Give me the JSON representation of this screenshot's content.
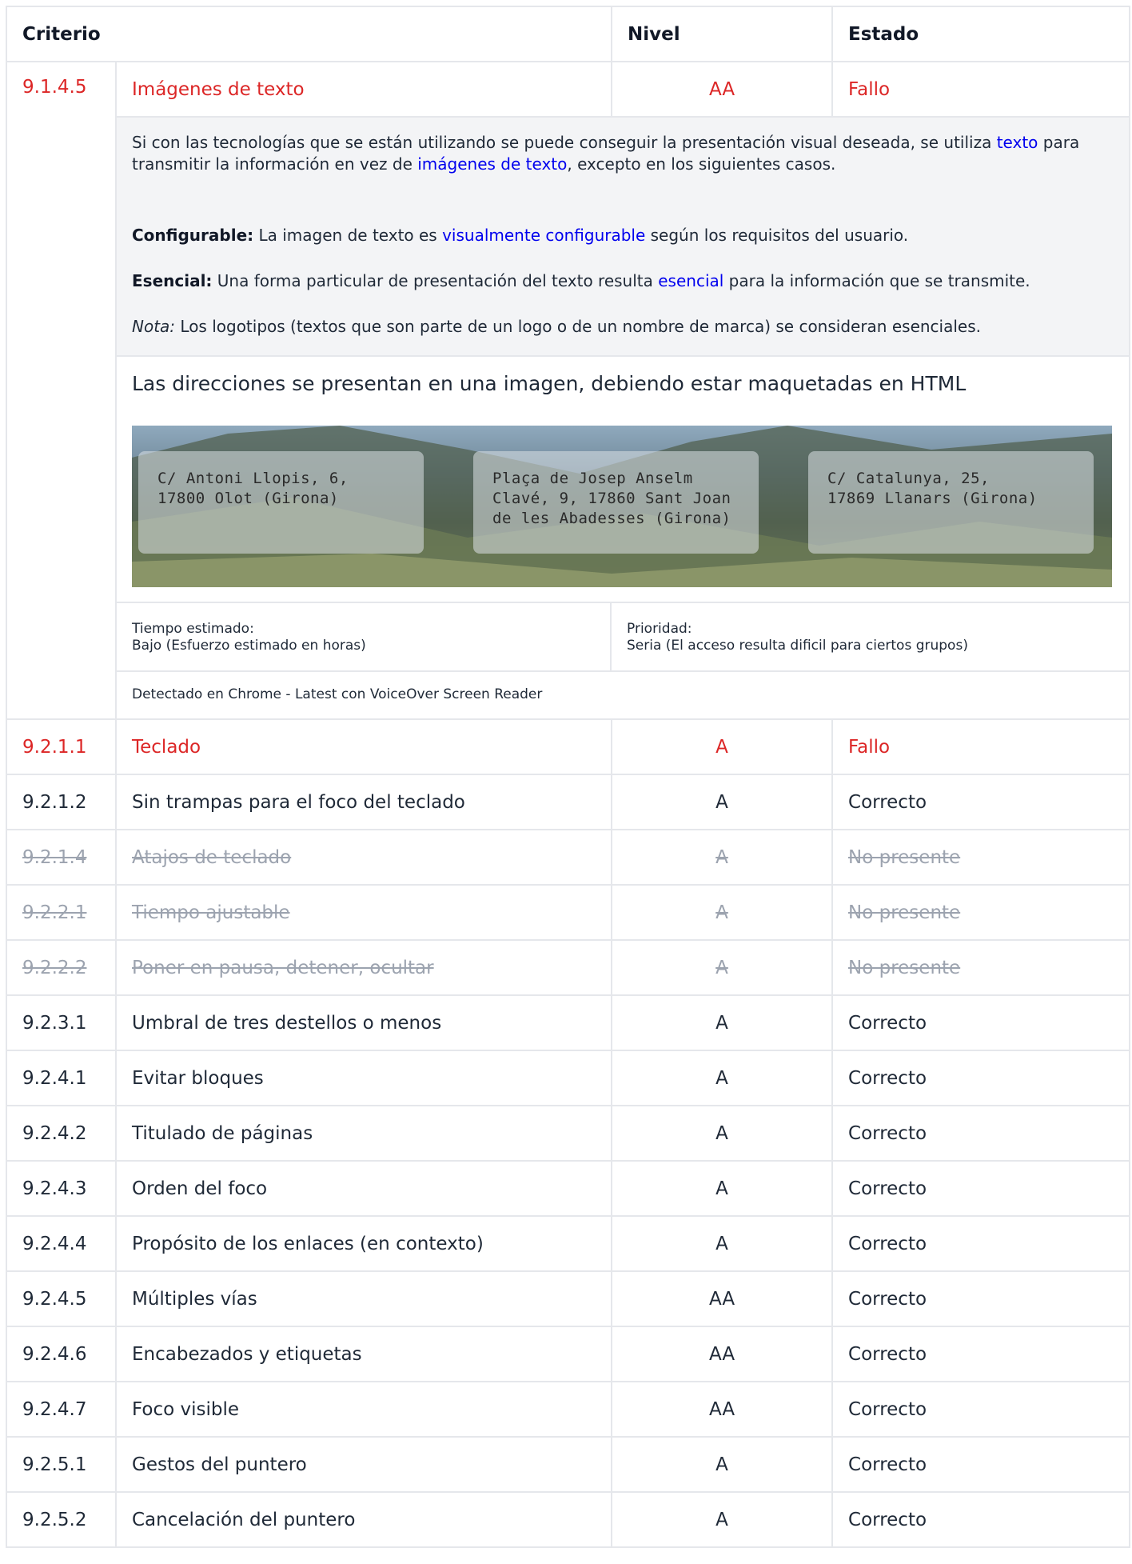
{
  "header": {
    "criterio": "Criterio",
    "nivel": "Nivel",
    "estado": "Estado"
  },
  "expanded": {
    "id": "9.1.4.5",
    "name": "Imágenes de texto",
    "nivel": "AA",
    "estado": "Fallo",
    "desc1_a": "Si con las tecnologías que se están utilizando se puede conseguir la presentación visual deseada, se utiliza ",
    "desc1_link1": "texto",
    "desc1_b": " para transmitir la información en vez de ",
    "desc1_link2": "imágenes de texto",
    "desc1_c": ", excepto en los siguientes casos.",
    "config_label": "Configurable:",
    "config_a": " La imagen de texto es ",
    "config_link": "visualmente configurable",
    "config_b": " según los requisitos del usuario.",
    "esencial_label": "Esencial:",
    "esencial_a": " Una forma particular de presentación del texto resulta ",
    "esencial_link": "esencial",
    "esencial_b": " para la información que se transmite.",
    "nota_label": "Nota:",
    "nota_text": " Los logotipos (textos que son parte de un logo o de un nombre de marca) se consideran esenciales.",
    "issue_title": "Las direcciones se presentan en una imagen, debiendo estar maquetadas en HTML",
    "addresses": [
      {
        "line1": "C/ Antoni Llopis, 6,",
        "line2": "17800 Olot (Girona)",
        "line3": ""
      },
      {
        "line1": "Plaça de Josep Anselm",
        "line2": "Clavé, 9, 17860 Sant Joan",
        "line3": "de les Abadesses (Girona)"
      },
      {
        "line1": "C/ Catalunya, 25,",
        "line2": "17869 Llanars (Girona)",
        "line3": ""
      }
    ],
    "tiempo_label": "Tiempo estimado:",
    "tiempo_value": "Bajo (Esfuerzo estimado en horas)",
    "prioridad_label": "Prioridad:",
    "prioridad_value": "Seria (El acceso resulta dificil para ciertos grupos)",
    "detected": "Detectado en Chrome - Latest con VoiceOver Screen Reader"
  },
  "rows": [
    {
      "id": "9.2.1.1",
      "name": "Teclado",
      "nivel": "A",
      "estado": "Fallo"
    },
    {
      "id": "9.2.1.2",
      "name": "Sin trampas para el foco del teclado",
      "nivel": "A",
      "estado": "Correcto"
    },
    {
      "id": "9.2.1.4",
      "name": "Atajos de teclado",
      "nivel": "A",
      "estado": "No presente"
    },
    {
      "id": "9.2.2.1",
      "name": "Tiempo ajustable",
      "nivel": "A",
      "estado": "No presente"
    },
    {
      "id": "9.2.2.2",
      "name": "Poner en pausa, detener, ocultar",
      "nivel": "A",
      "estado": "No presente"
    },
    {
      "id": "9.2.3.1",
      "name": "Umbral de tres destellos o menos",
      "nivel": "A",
      "estado": "Correcto"
    },
    {
      "id": "9.2.4.1",
      "name": "Evitar bloques",
      "nivel": "A",
      "estado": "Correcto"
    },
    {
      "id": "9.2.4.2",
      "name": "Titulado de páginas",
      "nivel": "A",
      "estado": "Correcto"
    },
    {
      "id": "9.2.4.3",
      "name": "Orden del foco",
      "nivel": "A",
      "estado": "Correcto"
    },
    {
      "id": "9.2.4.4",
      "name": "Propósito de los enlaces (en contexto)",
      "nivel": "A",
      "estado": "Correcto"
    },
    {
      "id": "9.2.4.5",
      "name": "Múltiples vías",
      "nivel": "AA",
      "estado": "Correcto"
    },
    {
      "id": "9.2.4.6",
      "name": "Encabezados y etiquetas",
      "nivel": "AA",
      "estado": "Correcto"
    },
    {
      "id": "9.2.4.7",
      "name": "Foco visible",
      "nivel": "AA",
      "estado": "Correcto"
    },
    {
      "id": "9.2.5.1",
      "name": "Gestos del puntero",
      "nivel": "A",
      "estado": "Correcto"
    },
    {
      "id": "9.2.5.2",
      "name": "Cancelación del puntero",
      "nivel": "A",
      "estado": "Correcto"
    }
  ],
  "colors": {
    "fail": "#dc2626",
    "not_present": "#9ca3af",
    "link": "#0000ee"
  }
}
